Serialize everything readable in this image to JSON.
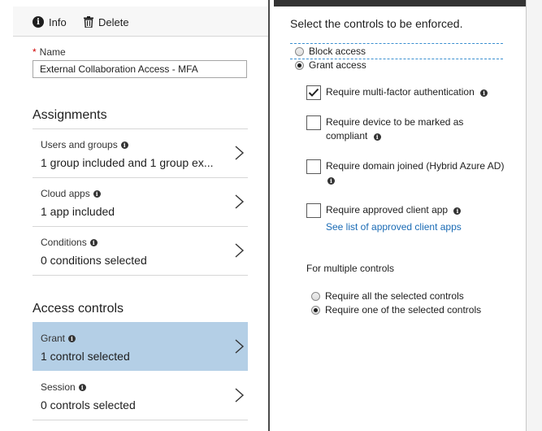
{
  "toolbar": {
    "info_label": "Info",
    "delete_label": "Delete"
  },
  "name_field": {
    "label": "Name",
    "required_marker": "*",
    "value": "External Collaboration Access - MFA"
  },
  "assignments": {
    "title": "Assignments",
    "items": [
      {
        "label": "Users and groups",
        "value": "1 group included and 1 group ex..."
      },
      {
        "label": "Cloud apps",
        "value": "1 app included"
      },
      {
        "label": "Conditions",
        "value": "0 conditions selected"
      }
    ]
  },
  "access_controls": {
    "title": "Access controls",
    "items": [
      {
        "label": "Grant",
        "value": "1 control selected",
        "selected": true
      },
      {
        "label": "Session",
        "value": "0 controls selected",
        "selected": false
      }
    ]
  },
  "grant_panel": {
    "heading": "Select the controls to be enforced.",
    "access_options": [
      {
        "label": "Block access",
        "checked": false
      },
      {
        "label": "Grant access",
        "checked": true
      }
    ],
    "controls": [
      {
        "line1": "Require multi-factor authentication",
        "line2": "",
        "checked": true
      },
      {
        "line1": "Require device to be marked as",
        "line2": "compliant",
        "checked": false
      },
      {
        "line1": "Require domain joined (Hybrid Azure AD)",
        "line2": "",
        "checked": false
      },
      {
        "line1": "Require approved client app",
        "line2": "",
        "checked": false
      }
    ],
    "approved_apps_link": "See list of approved client apps",
    "multiple_controls_label": "For multiple controls",
    "multiple_options": [
      {
        "label": "Require all the selected controls",
        "checked": false
      },
      {
        "label": "Require one of the selected controls",
        "checked": true
      }
    ]
  }
}
